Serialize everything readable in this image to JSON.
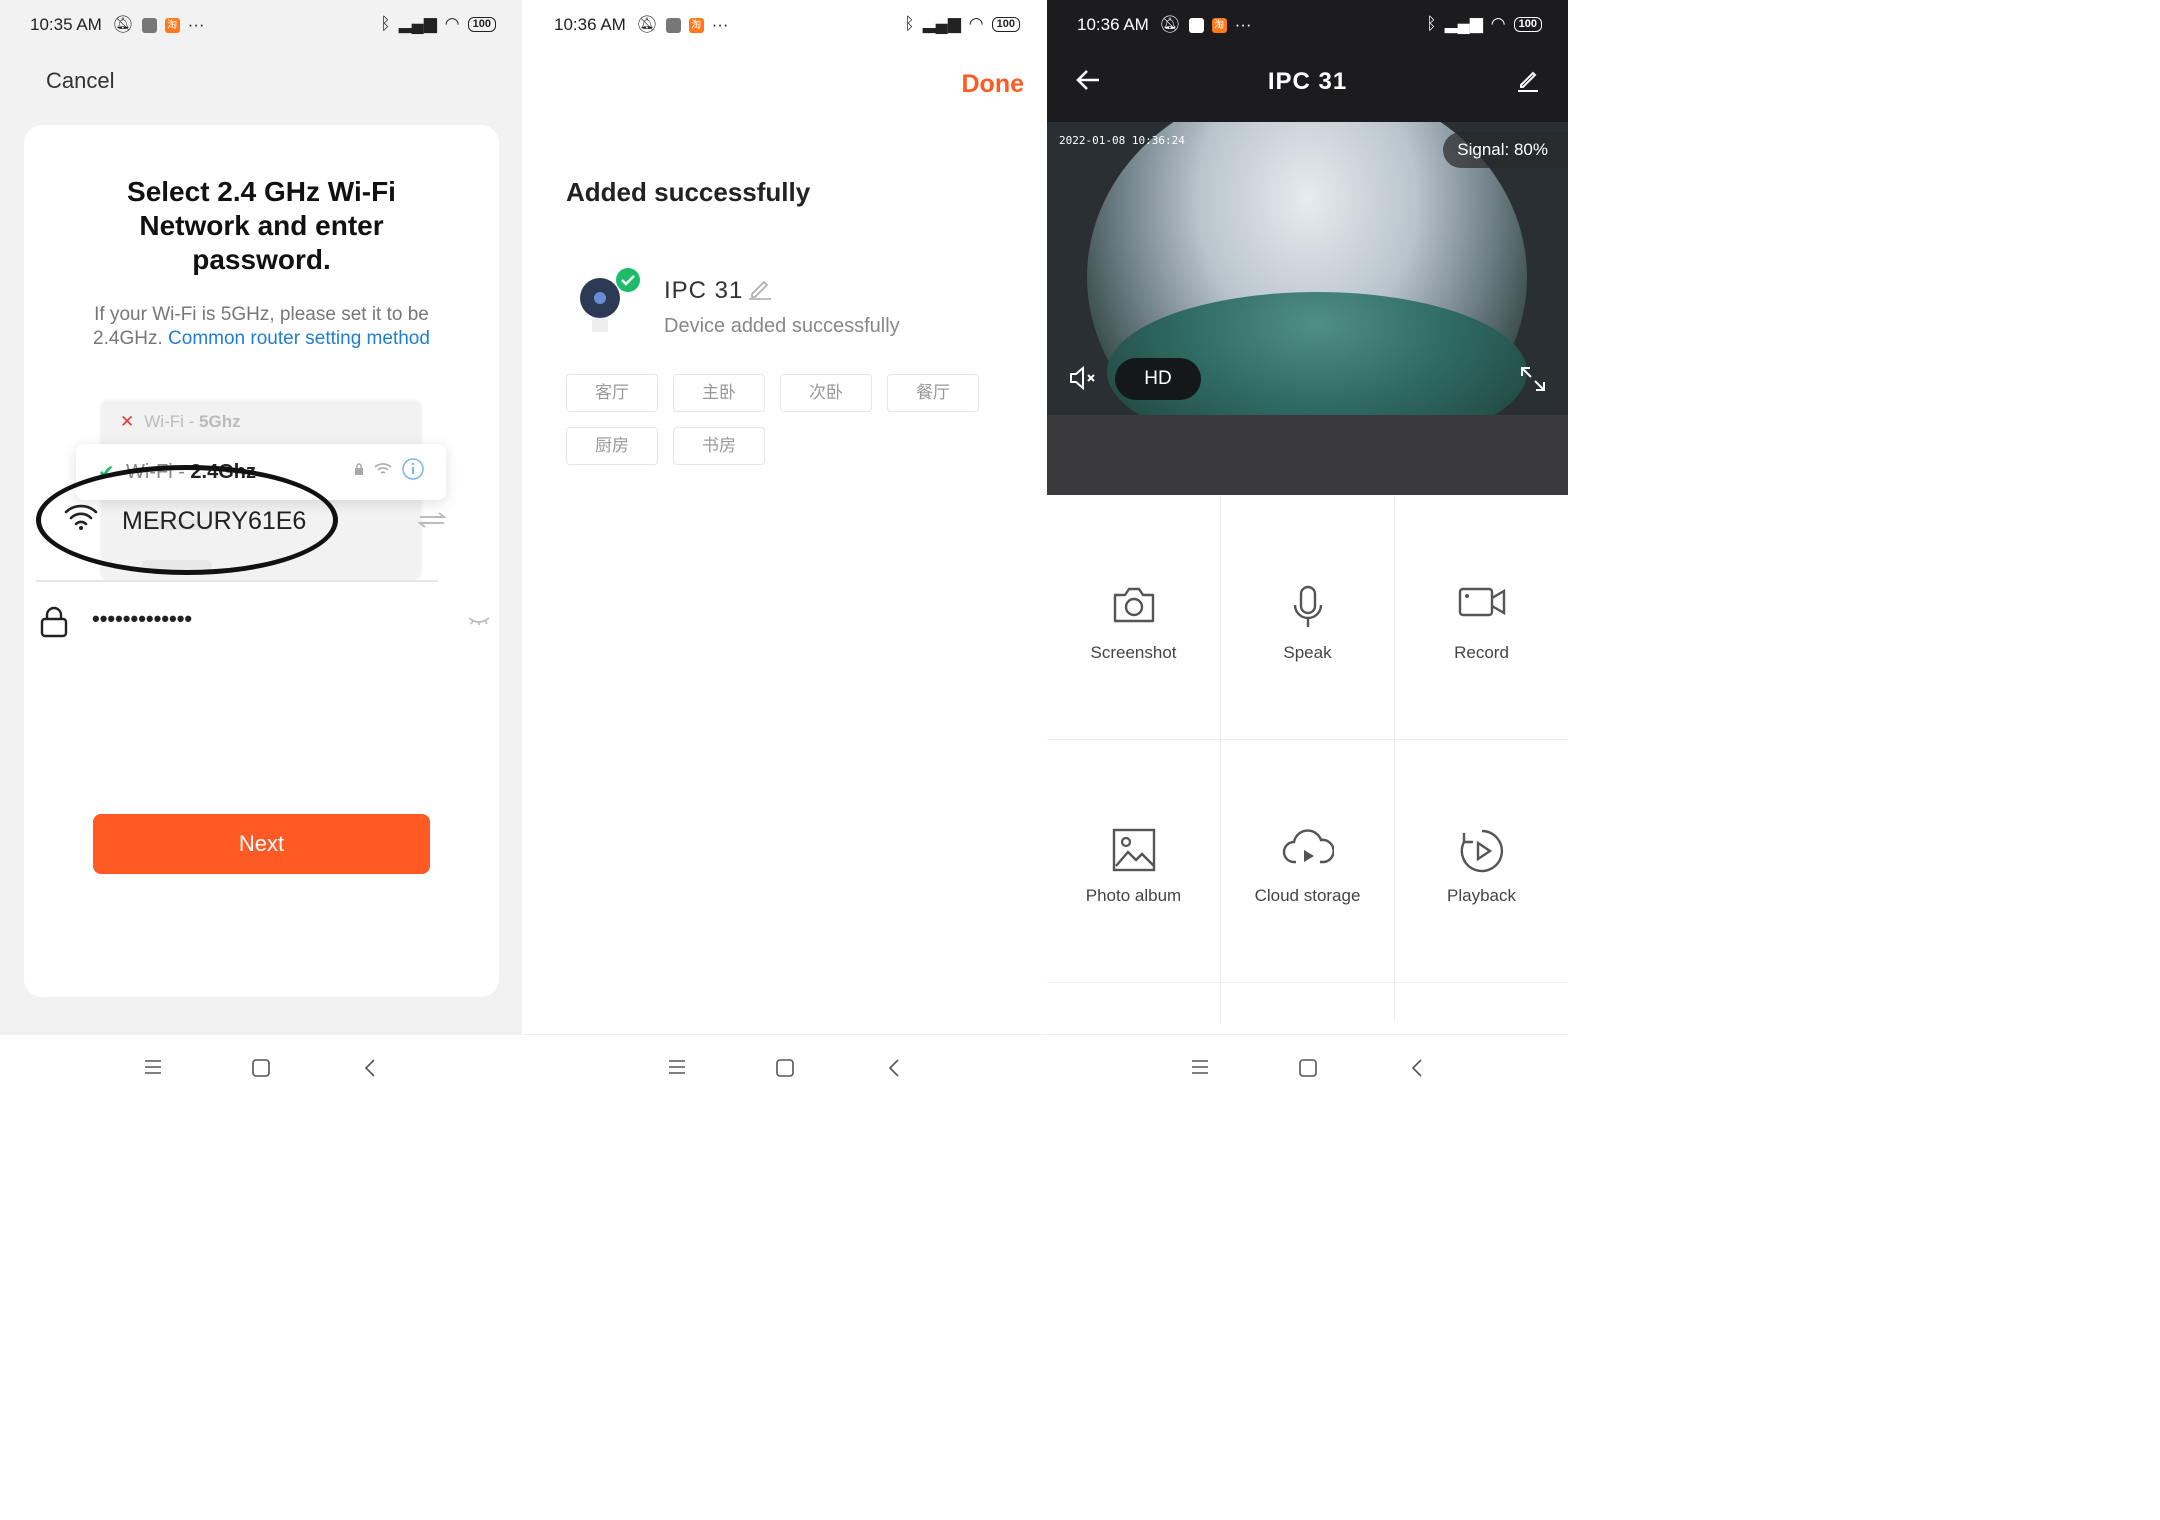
{
  "screen1": {
    "status": {
      "time": "10:35 AM",
      "battery": "100"
    },
    "cancel": "Cancel",
    "title": "Select 2.4 GHz Wi-Fi Network and enter password.",
    "desc_text": "If your Wi-Fi is 5GHz, please set it to be 2.4GHz.",
    "desc_link": "Common router setting method",
    "wifi_bad_prefix": "Wi-Fi - ",
    "wifi_bad_band": "5Ghz",
    "wifi_good_prefix": "Wi-Fi - ",
    "wifi_good_band": "2.4Ghz",
    "ssid": "MERCURY61E6",
    "password_masked": "•••••••••••••",
    "next": "Next"
  },
  "screen2": {
    "status": {
      "time": "10:36 AM",
      "battery": "100"
    },
    "done": "Done",
    "added_title": "Added successfully",
    "device_name": "IPC  31",
    "device_status": "Device added successfully",
    "rooms": [
      "客厅",
      "主卧",
      "次卧",
      "餐厅",
      "厨房",
      "书房"
    ]
  },
  "screen3": {
    "status": {
      "time": "10:36 AM",
      "battery": "100"
    },
    "title": "IPC  31",
    "video_timestamp": "2022-01-08  10:36:24",
    "signal": "Signal: 80%",
    "quality": "HD",
    "actions": [
      "Screenshot",
      "Speak",
      "Record",
      "Photo album",
      "Cloud storage",
      "Playback"
    ]
  },
  "colors": {
    "accent": "#ff5a24",
    "link": "#1e7fd0",
    "success": "#1ebc6a",
    "dark": "#1c1c1e"
  }
}
